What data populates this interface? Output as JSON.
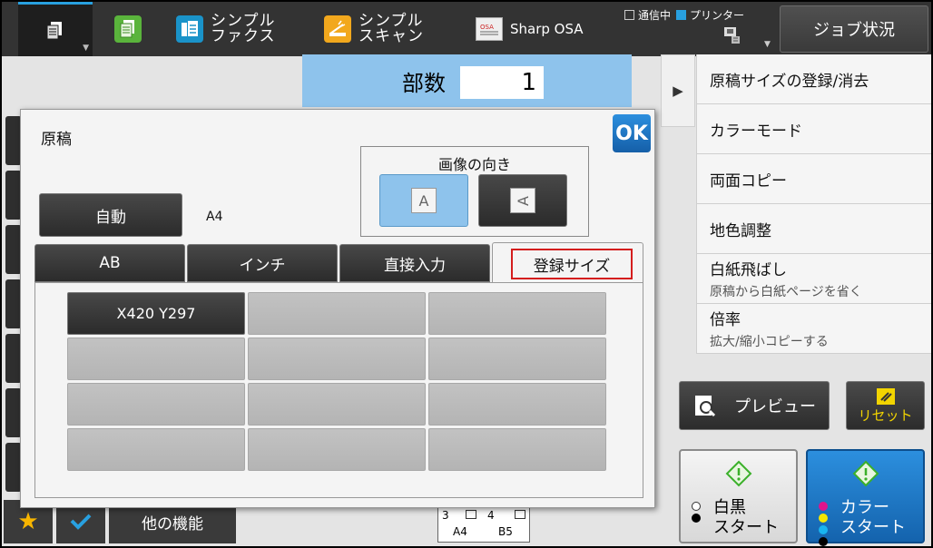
{
  "topbar": {
    "apps": [
      {
        "label1": "シンプル",
        "label2": "ファクス",
        "icon": "fax-icon"
      },
      {
        "label1": "シンプル",
        "label2": "スキャン",
        "icon": "scan-icon"
      }
    ],
    "sharp_osa": "Sharp OSA",
    "status_comm": "通信中",
    "status_printer": "プリンター",
    "job_status": "ジョブ状況"
  },
  "copies": {
    "label": "部数",
    "value": "1"
  },
  "right_menu": [
    {
      "title": "原稿サイズの登録/消去",
      "sub": ""
    },
    {
      "title": "カラーモード",
      "sub": ""
    },
    {
      "title": "両面コピー",
      "sub": ""
    },
    {
      "title": "地色調整",
      "sub": ""
    },
    {
      "title": "白紙飛ばし",
      "sub": "原稿から白紙ページを省く"
    },
    {
      "title": "倍率",
      "sub": "拡大/縮小コピーする"
    }
  ],
  "preview": "プレビュー",
  "reset": "リセット",
  "bw_start": {
    "line1": "白黒",
    "line2": "スタート"
  },
  "color_start": {
    "line1": "カラー",
    "line2": "スタート"
  },
  "bottom": {
    "other": "他の機能"
  },
  "paper": {
    "t1_num": "3",
    "t1_size": "A4",
    "t2_num": "4",
    "t2_size": "B5"
  },
  "dialog": {
    "title": "原稿",
    "ok": "OK",
    "auto": "自動",
    "size": "A4",
    "orientation_title": "画像の向き",
    "page_letter": "A",
    "tabs": [
      "AB",
      "インチ",
      "直接入力",
      "登録サイズ"
    ],
    "cells": [
      "X420 Y297",
      "",
      "",
      "",
      "",
      "",
      "",
      "",
      "",
      "",
      "",
      ""
    ]
  },
  "colors": {
    "accent": "#8ec3ec",
    "highlight": "#d41d1d",
    "ok": "#1f78c4",
    "reset_text": "#f2d400"
  }
}
